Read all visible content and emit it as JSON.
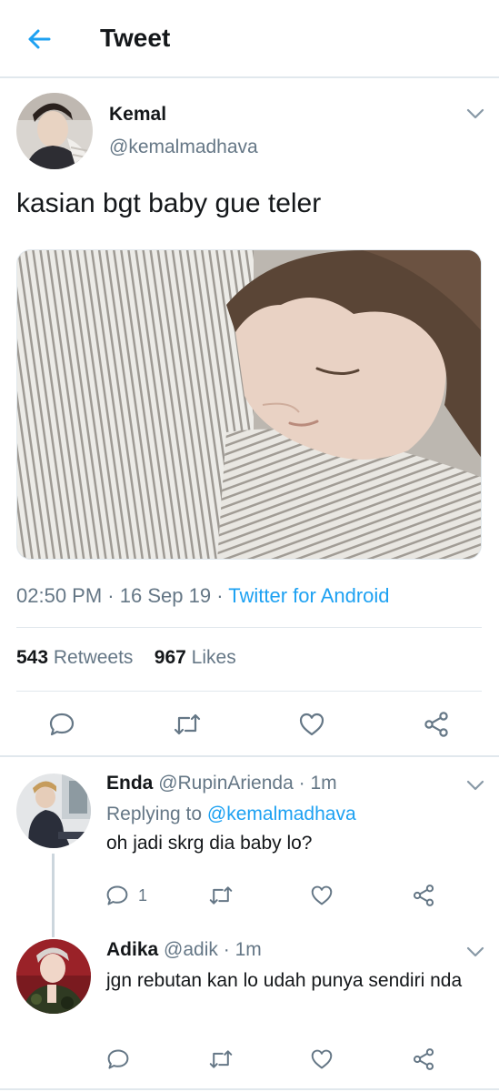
{
  "header": {
    "title": "Tweet"
  },
  "tweet": {
    "author_name": "Kemal",
    "author_handle": "@kemalmadhava",
    "text": "kasian bgt baby gue teler",
    "time": "02:50 PM",
    "date": "16 Sep 19",
    "sep": "·",
    "client": "Twitter for Android",
    "retweets_count": "543",
    "retweets_label": "Retweets",
    "likes_count": "967",
    "likes_label": "Likes"
  },
  "replies": [
    {
      "name": "Enda",
      "handle": "@RupinArienda",
      "time": "1m",
      "replying_prefix": "Replying to",
      "replying_to": "@kemalmadhava",
      "text": "oh jadi skrg dia baby lo?",
      "reply_count": "1"
    },
    {
      "name": "Adika",
      "handle": "@adik",
      "time": "1m",
      "text": "jgn rebutan kan lo udah punya sendiri nda"
    }
  ],
  "colors": {
    "accent": "#1da1f2",
    "secondary_text": "#657786",
    "divider": "#e1e8ed"
  },
  "icons": {
    "back": "arrow-left-icon",
    "reply": "speech-bubble-icon",
    "retweet": "retweet-icon",
    "like": "heart-icon",
    "share": "share-icon",
    "caret": "chevron-down-icon"
  }
}
